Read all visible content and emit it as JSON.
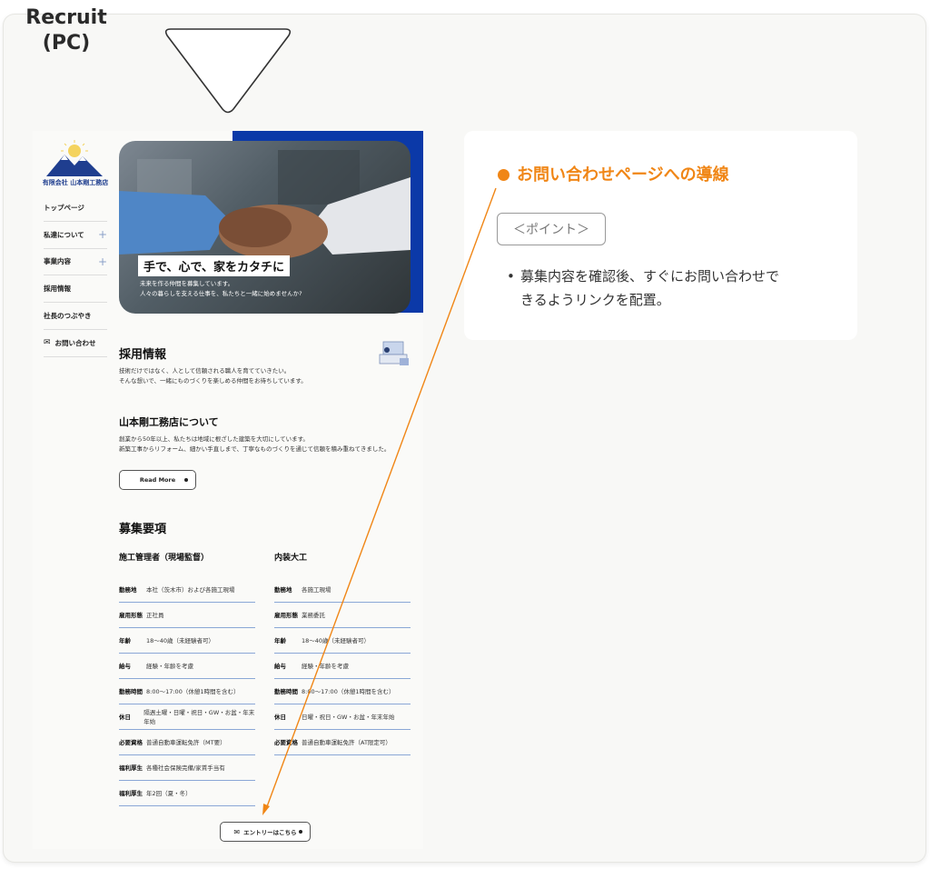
{
  "badge": {
    "line1": "Recruit",
    "line2": "(PC)"
  },
  "site": {
    "logo_text": "有限会社 山本剛工務店",
    "nav": [
      {
        "label": "トップページ",
        "has_plus": false
      },
      {
        "label": "私達について",
        "has_plus": true
      },
      {
        "label": "事業内容",
        "has_plus": true
      },
      {
        "label": "採用情報",
        "has_plus": false
      },
      {
        "label": "社長のつぶやき",
        "has_plus": false
      },
      {
        "label": "お問い合わせ",
        "has_plus": false,
        "icon": "mail-icon"
      }
    ],
    "hero": {
      "title": "手で、心で、家をカタチに",
      "sub1": "未来を作る仲間を募集しています。",
      "sub2": "人々の暮らしを支える仕事を、私たちと一緒に始めませんか?"
    },
    "recruit": {
      "title": "採用情報",
      "p1": "技術だけではなく、人として信頼される職人を育てていきたい。",
      "p2": "そんな想いで、一緒にものづくりを楽しめる仲間をお待ちしています。"
    },
    "about": {
      "title": "山本剛工務店について",
      "p1": "創業から50年以上、私たちは地域に根ざした建築を大切にしています。",
      "p2": "新築工事からリフォーム、細かい手直しまで、丁寧なものづくりを通じて信頼を積み重ねてきました。",
      "button": "Read More"
    },
    "jobs": {
      "title": "募集要項",
      "col1": {
        "title": "施工管理者（現場監督）",
        "rows": [
          {
            "k": "勤務地",
            "v": "本社（茨木市）および各施工現場"
          },
          {
            "k": "雇用形態",
            "v": "正社員"
          },
          {
            "k": "年齢",
            "v": "18〜40歳（未経験者可）"
          },
          {
            "k": "給与",
            "v": "経験・年齢を考慮"
          },
          {
            "k": "勤務時間",
            "v": "8:00〜17:00（休憩1時間を含む）"
          },
          {
            "k": "休日",
            "v": "隔週土曜・日曜・祝日・GW・お盆・年末年始"
          },
          {
            "k": "必要資格",
            "v": "普通自動車運転免許（MT要）"
          },
          {
            "k": "福利厚生",
            "v": "各種社会保険完備/家賃手当有"
          },
          {
            "k": "福利厚生",
            "v": "年2回（夏・冬）"
          }
        ]
      },
      "col2": {
        "title": "内装大工",
        "rows": [
          {
            "k": "勤務地",
            "v": "各施工現場"
          },
          {
            "k": "雇用形態",
            "v": "業務委託"
          },
          {
            "k": "年齢",
            "v": "18〜40歳（未経験者可）"
          },
          {
            "k": "給与",
            "v": "経験・年齢を考慮"
          },
          {
            "k": "勤務時間",
            "v": "8:00〜17:00（休憩1時間を含む）"
          },
          {
            "k": "休日",
            "v": "日曜・祝日・GW・お盆・年末年始"
          },
          {
            "k": "必要資格",
            "v": "普通自動車運転免許（AT限定可）"
          }
        ]
      },
      "entry_button": "エントリーはこちら"
    }
  },
  "card": {
    "title": "お問い合わせページへの導線",
    "point": "＜ポイント＞",
    "bullet_line1": "募集内容を確認後、すぐにお問い合わせで",
    "bullet_line2": "きるようリンクを配置。"
  },
  "colors": {
    "accent": "#f08616",
    "brand_blue": "#0b39a8",
    "rule_blue": "#8aa7d6"
  }
}
